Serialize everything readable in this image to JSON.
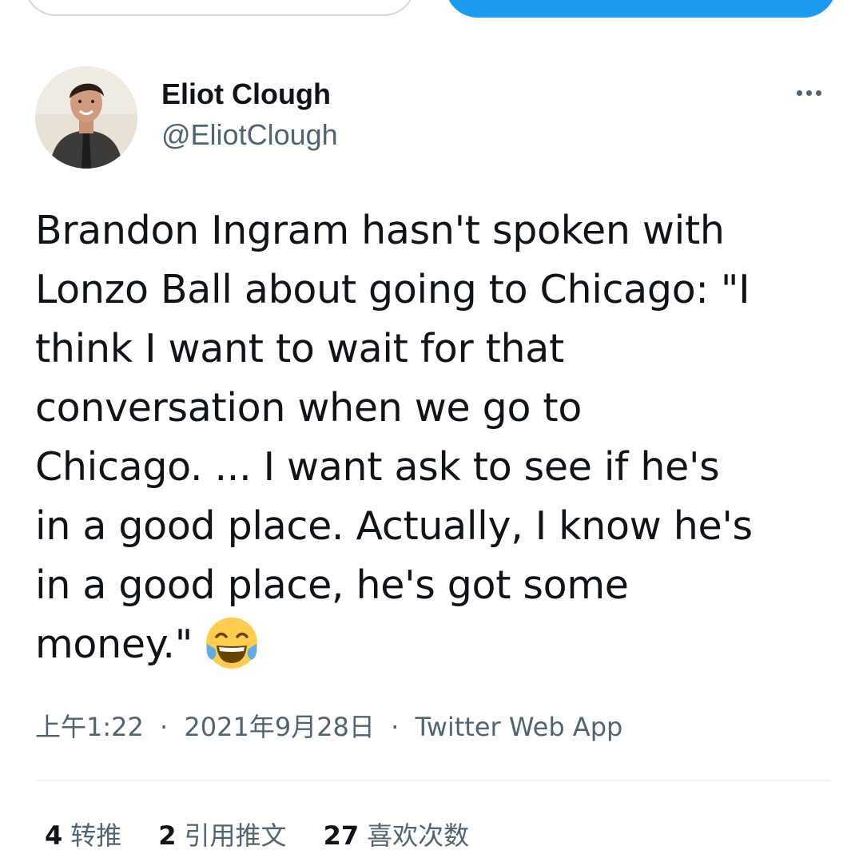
{
  "author": {
    "display_name": "Eliot Clough",
    "handle": "@EliotClough"
  },
  "tweet": {
    "lines": [
      "Brandon Ingram hasn't spoken with",
      "Lonzo Ball about going to Chicago: \"I",
      "think I want to wait for that",
      "conversation when we go to",
      "Chicago. ... I want ask to see if he's",
      "in a good place. Actually, I know he's",
      "in a good place, he's got some",
      "money.\""
    ],
    "emoji": "face-with-tears-of-joy"
  },
  "meta": {
    "time": "上午1:22",
    "separator": "·",
    "date": "2021年9月28日",
    "source": "Twitter Web App"
  },
  "stats": {
    "retweets": {
      "count": "4",
      "label": "转推"
    },
    "quotes": {
      "count": "2",
      "label": "引用推文"
    },
    "likes": {
      "count": "27",
      "label": "喜欢次数"
    }
  },
  "colors": {
    "accent": "#1d9bf0",
    "text_primary": "#0f1419",
    "text_secondary": "#536471",
    "border": "#cfd9de"
  }
}
